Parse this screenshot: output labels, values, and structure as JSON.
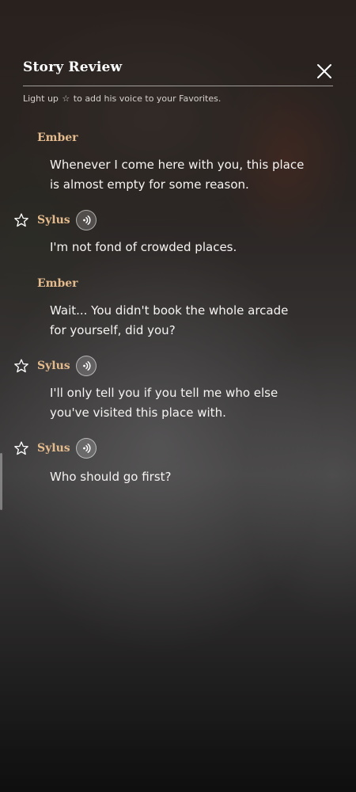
{
  "header": {
    "title": "Story Review",
    "subtitle_pre": "Light up",
    "subtitle_star": "☆",
    "subtitle_post": "to add his voice to your Favorites."
  },
  "icons": {
    "close": "close-icon",
    "star": "star-outline-icon",
    "voice": "voice-play-icon"
  },
  "colors": {
    "speaker": "#e4bb8d",
    "text": "#f6f4f2"
  },
  "dialogue": [
    {
      "speaker": "Ember",
      "text_lines": [
        "Whenever I come here with you, this place",
        "is almost empty for some reason."
      ],
      "has_voice": false
    },
    {
      "speaker": "Sylus",
      "text_lines": [
        "I'm not fond of crowded places."
      ],
      "has_voice": true
    },
    {
      "speaker": "Ember",
      "text_lines": [
        "Wait... You didn't book the whole arcade",
        "for yourself, did you?"
      ],
      "has_voice": false
    },
    {
      "speaker": "Sylus",
      "text_lines": [
        "I'll only tell you if you tell me who else",
        "you've visited this place with."
      ],
      "has_voice": true
    },
    {
      "speaker": "Sylus",
      "text_lines": [
        "Who should go first?"
      ],
      "has_voice": true
    }
  ]
}
